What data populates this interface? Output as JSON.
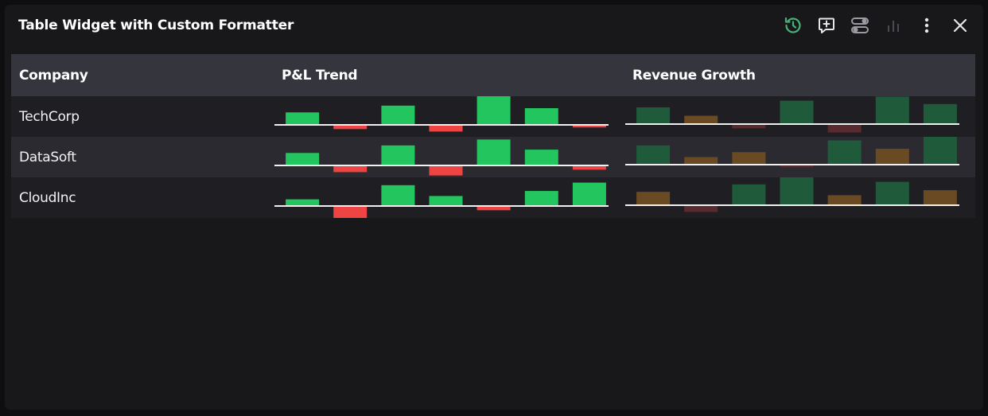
{
  "widget": {
    "title": "Table Widget with Custom Formatter"
  },
  "toolbar": [
    {
      "name": "history-icon",
      "color": "#4caf7a"
    },
    {
      "name": "comment-add-icon",
      "color": "#e6e6e6"
    },
    {
      "name": "settings-toggles-icon",
      "color": "#9a9aa2"
    },
    {
      "name": "bar-chart-icon",
      "color": "#4a4a52"
    },
    {
      "name": "more-vertical-icon",
      "color": "#e6e6e6"
    },
    {
      "name": "close-icon",
      "color": "#e6e6e6"
    }
  ],
  "table": {
    "columns": [
      "Company",
      "P&L Trend",
      "Revenue Growth"
    ],
    "rows": [
      {
        "company": "TechCorp",
        "pnl_trend": [
          15,
          -5,
          23,
          -8,
          35,
          20,
          -3
        ],
        "revenue_growth": [
          20,
          10,
          -5,
          28,
          -10,
          33,
          24
        ]
      },
      {
        "company": "DataSoft",
        "pnl_trend": [
          15,
          -8,
          24,
          -12,
          31,
          19,
          -5
        ],
        "revenue_growth": [
          23,
          9,
          15,
          -3,
          29,
          19,
          42
        ]
      },
      {
        "company": "CloudInc",
        "pnl_trend": [
          8,
          -15,
          25,
          12,
          -5,
          18,
          28
        ],
        "revenue_growth": [
          16,
          -8,
          25,
          38,
          12,
          28,
          18
        ]
      }
    ]
  },
  "colors": {
    "pnl_positive": "#22c55e",
    "pnl_negative": "#ef4444",
    "growth_high": "#1f5a3a",
    "growth_mid": "#6a4a22",
    "growth_negative": "#5a2a2e",
    "baseline": "#f0f0f0"
  }
}
